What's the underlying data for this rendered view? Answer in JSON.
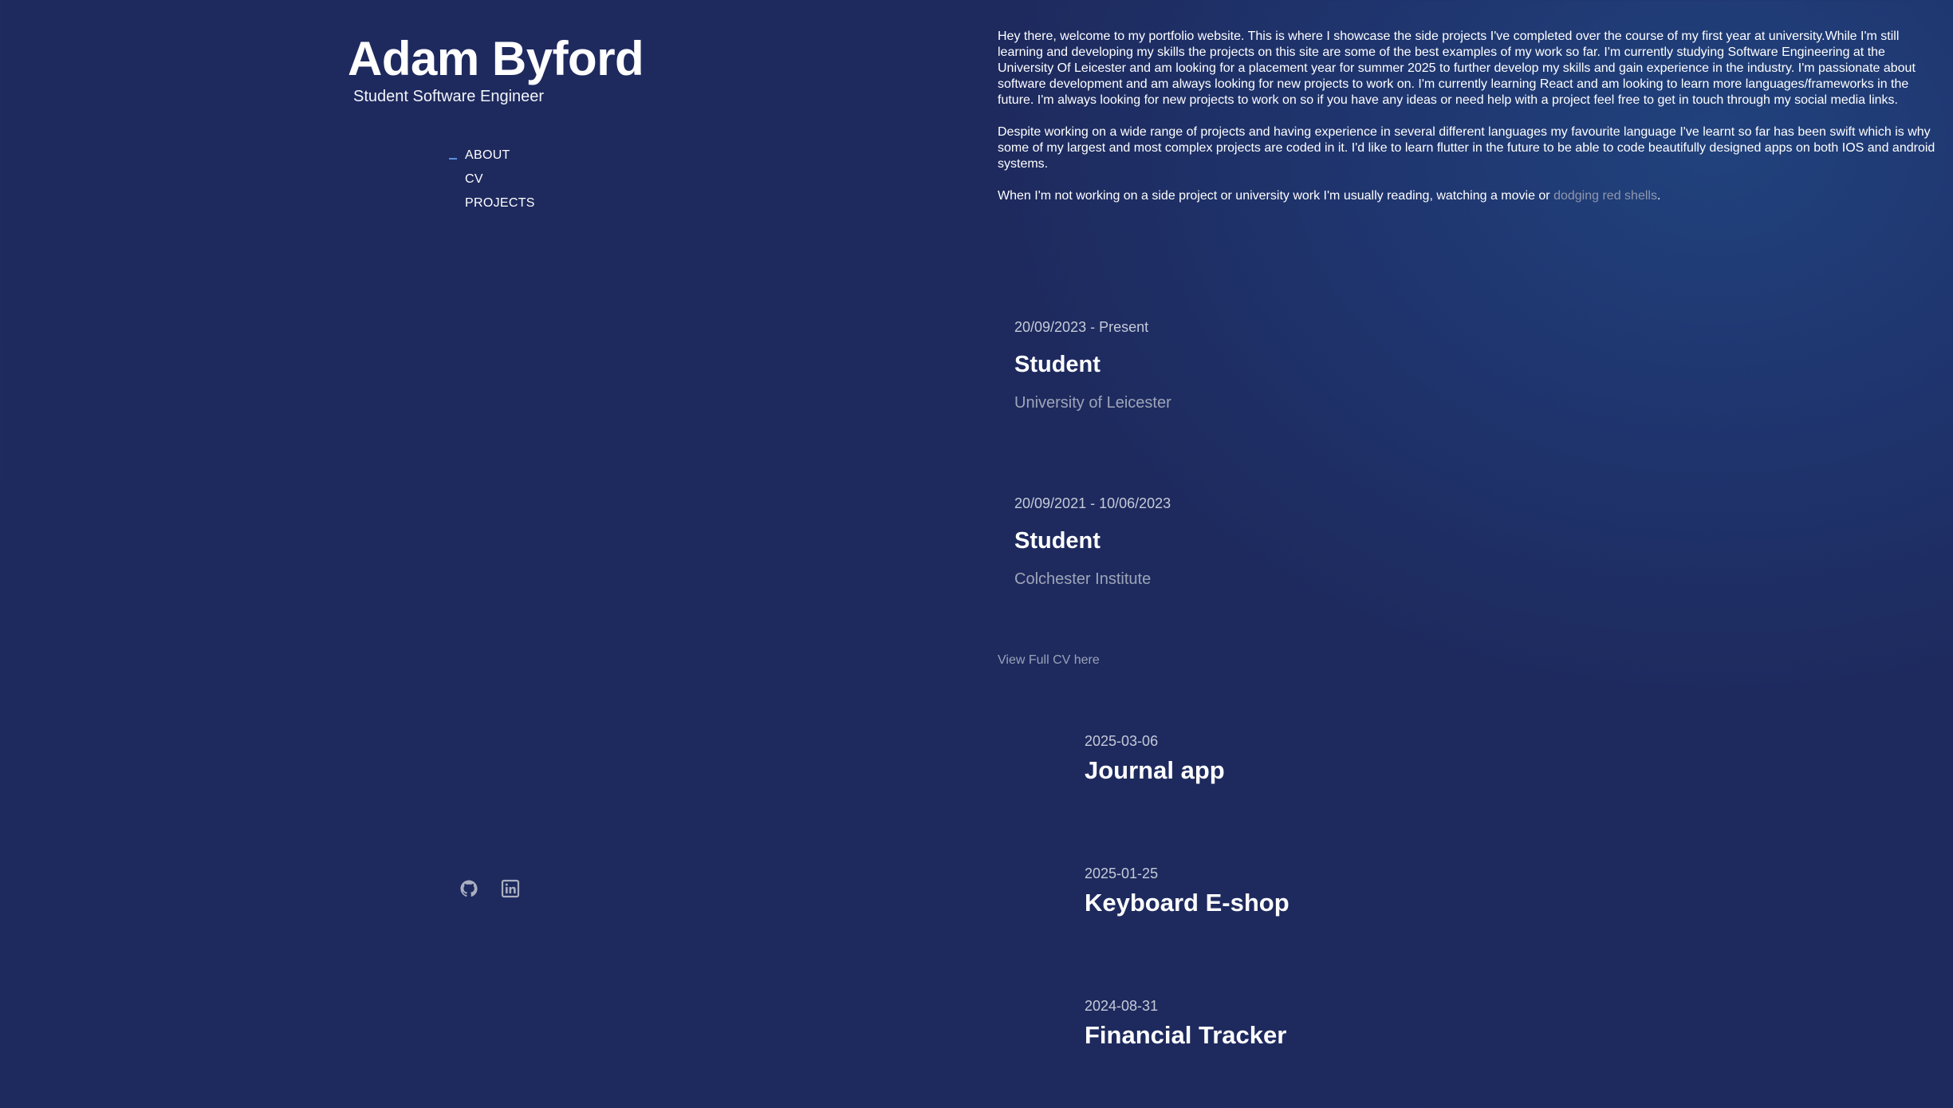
{
  "header": {
    "name": "Adam Byford",
    "tagline": "Student Software Engineer"
  },
  "nav": {
    "items": [
      {
        "label": "ABOUT",
        "active": true
      },
      {
        "label": "CV",
        "active": false
      },
      {
        "label": "PROJECTS",
        "active": false
      }
    ]
  },
  "socials": [
    {
      "icon": "github-icon"
    },
    {
      "icon": "linkedin-icon"
    }
  ],
  "about": {
    "paragraph1": "Hey there, welcome to my portfolio website. This is where I showcase the side projects I've completed over the course of my first year at university.While I'm still learning and developing my skills the projects on this site are some of the best examples of my work so far. I'm currently studying Software Engineering at the University Of Leicester and am looking for a placement year for summer 2025 to further develop my skills and gain experience in the industry. I'm passionate about software development and am always looking for new projects to work on. I'm currently learning React and am looking to learn more languages/frameworks in the future. I'm always looking for new projects to work on so if you have any ideas or need help with a project feel free to get in touch through my social media links.",
    "paragraph2": "Despite working on a wide range of projects and having experience in several different languages my favourite language I've learnt so far has been swift which is why some of my largest and most complex projects are coded in it. I'd like to learn flutter in the future to be able to code beautifully designed apps on both IOS and android systems.",
    "paragraph3_before": "When I'm not working on a side project or university work I'm usually reading, watching a movie or ",
    "paragraph3_link": "dodging red shells",
    "paragraph3_after": "."
  },
  "cv": {
    "entries": [
      {
        "date": "20/09/2023 - Present",
        "title": "Student",
        "org": "University of Leicester"
      },
      {
        "date": "20/09/2021 - 10/06/2023",
        "title": "Student",
        "org": "Colchester Institute"
      }
    ],
    "full_cv_link": "View Full CV here"
  },
  "projects": [
    {
      "date": "2025-03-06",
      "title": "Journal app"
    },
    {
      "date": "2025-01-25",
      "title": "Keyboard E-shop"
    },
    {
      "date": "2024-08-31",
      "title": "Financial Tracker"
    }
  ],
  "colors": {
    "background": "#1e2a5e",
    "accent": "#5f8fe0",
    "muted_text": "#9ea5b8"
  }
}
